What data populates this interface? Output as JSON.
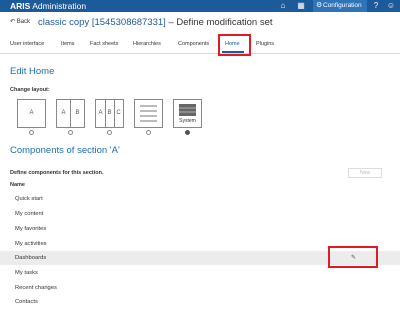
{
  "header": {
    "app_brand": "ARIS",
    "app_name": "Administration",
    "configuration_label": "Configuration"
  },
  "title_row": {
    "back_label": "Back",
    "title_link": "classic copy [1545308687331]",
    "title_sep": "–",
    "title_suffix": "Define modification set"
  },
  "tabs": [
    {
      "label": "User interface"
    },
    {
      "label": "Items"
    },
    {
      "label": "Fact sheets"
    },
    {
      "label": "Hierarchies"
    },
    {
      "label": "Components"
    },
    {
      "label": "Home"
    },
    {
      "label": "Plugins"
    }
  ],
  "edit_home": {
    "heading": "Edit Home",
    "change_layout_label": "Change layout:",
    "layout_options": [
      {
        "cells": [
          "A"
        ]
      },
      {
        "cells": [
          "A",
          "B"
        ]
      },
      {
        "cells": [
          "A",
          "B",
          "C"
        ]
      },
      {
        "cells": []
      },
      {
        "cells": [
          "System"
        ],
        "selected": true
      }
    ]
  },
  "components": {
    "heading": "Components of section 'A'",
    "define_label": "Define components for this section.",
    "new_button": "New",
    "column_header": "Name",
    "rows": [
      {
        "name": "Quick start"
      },
      {
        "name": "My content"
      },
      {
        "name": "My favorites"
      },
      {
        "name": "My activities"
      },
      {
        "name": "Dashboards",
        "hovered": true
      },
      {
        "name": "My tasks"
      },
      {
        "name": "Recent changes"
      },
      {
        "name": "Contacts"
      }
    ]
  },
  "colors": {
    "brand_bar": "#1c5a99",
    "accent": "#1c6fb0",
    "highlight": "#e11b22"
  }
}
